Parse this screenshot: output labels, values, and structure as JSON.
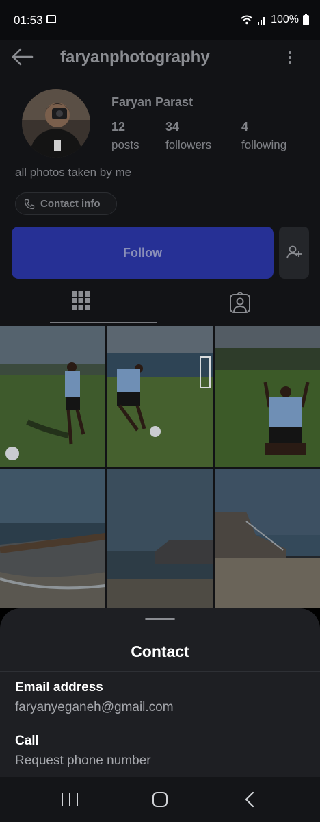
{
  "status_bar": {
    "time": "01:53",
    "battery": "100%"
  },
  "header": {
    "username": "faryanphotography"
  },
  "profile": {
    "display_name": "Faryan Parast",
    "stats": [
      {
        "value": "12",
        "label": "posts"
      },
      {
        "value": "34",
        "label": "followers"
      },
      {
        "value": "4",
        "label": "following"
      }
    ],
    "bio": "all photos taken by me",
    "contact_chip": "Contact info",
    "follow_button": "Follow"
  },
  "tabs": [
    {
      "icon": "grid-icon",
      "selected": true
    },
    {
      "icon": "tagged-person-icon",
      "selected": false
    }
  ],
  "contact_sheet": {
    "title": "Contact",
    "email_heading": "Email address",
    "email_value": "faryanyeganeh@gmail.com",
    "call_heading": "Call",
    "call_value": "Request phone number"
  },
  "colors": {
    "accent_follow": "#263095",
    "sheet_bg": "#1e1f23",
    "background": "#121316"
  }
}
